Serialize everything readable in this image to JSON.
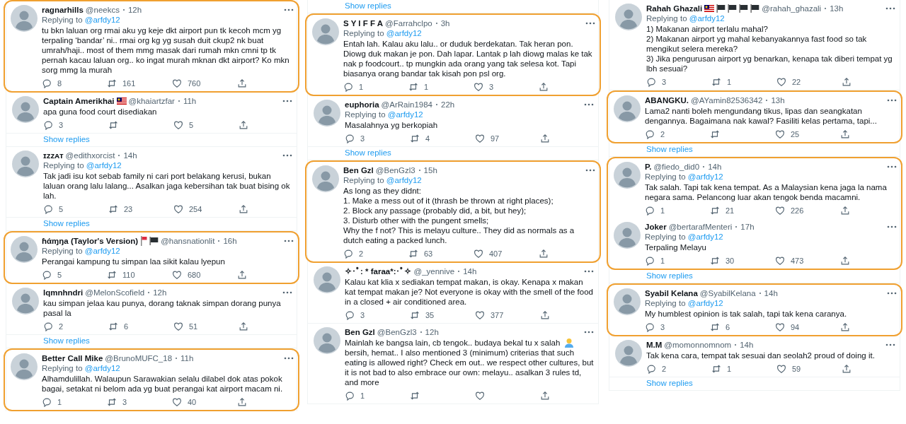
{
  "columns": [
    {
      "items": [
        {
          "kind": "tweet",
          "name": "ragnarhills",
          "handle": "@neekcs",
          "time": "12h",
          "reply_prefix": "Replying to",
          "reply_to": "@arfdy12",
          "text": [
            "tu bkn laluan org rmai aku yg keje dkt airport pun tk kecoh mcm yg terpaling ‘bandar’ ni.. rmai org kg yg susah duit ckup2 nk buat umrah/haji.. most of them mmg masak dari rumah mkn cmni tp tk pernah kacau laluan org.. ko ingat murah mknan dkt airport? Ko mkn sorg mmg la murah"
          ],
          "stats": {
            "replies": "8",
            "retweets": "161",
            "likes": "760"
          },
          "highlighted": true
        },
        {
          "kind": "tweet",
          "name": "Captain Amerikhai",
          "badges": [
            {
              "kind": "malaysia_flag"
            }
          ],
          "handle": "@khaiartzfar",
          "time": "11h",
          "text": [
            "apa guna food court disediakan"
          ],
          "stats": {
            "replies": "3",
            "likes": "5"
          },
          "highlighted": false
        },
        {
          "kind": "show_replies",
          "label": "Show replies"
        },
        {
          "kind": "tweet",
          "name": "ɪᴢᴢᴀᴛ",
          "handle": "@edithxorcist",
          "time": "14h",
          "reply_prefix": "Replying to",
          "reply_to": "@arfdy12",
          "text": [
            "Tak jadi isu kot sebab family ni cari port belakang kerusi, bukan laluan orang lalu lalang... Asalkan jaga kebersihan tak buat bising ok lah."
          ],
          "stats": {
            "replies": "5",
            "retweets": "23",
            "likes": "254"
          },
          "highlighted": false
        },
        {
          "kind": "show_replies",
          "label": "Show replies"
        },
        {
          "kind": "tweet",
          "name": "ɦάɱŋa (Taylor's Version)",
          "badges": [
            {
              "kind": "red_flag"
            },
            {
              "kind": "black_flag"
            }
          ],
          "handle": "@hansnationlit",
          "time": "16h",
          "reply_prefix": "Replying to",
          "reply_to": "@arfdy12",
          "text": [
            "Perangai kampung tu simpan laa sikit kalau lyepun"
          ],
          "stats": {
            "replies": "5",
            "retweets": "110",
            "likes": "680"
          },
          "highlighted": true
        },
        {
          "kind": "tweet",
          "name": "lqmnhndri",
          "handle": "@MelonScofield",
          "time": "12h",
          "text": [
            "kau simpan jelaa kau punya, dorang taknak simpan dorang punya pasal la"
          ],
          "stats": {
            "replies": "2",
            "retweets": "6",
            "likes": "51"
          },
          "highlighted": false
        },
        {
          "kind": "show_replies",
          "label": "Show replies"
        },
        {
          "kind": "tweet",
          "name": "Better Call Mike",
          "handle": "@BrunoMUFC_18",
          "time": "11h",
          "reply_prefix": "Replying to",
          "reply_to": "@arfdy12",
          "text": [
            "Alhamdulillah. Walaupun Sarawakian selalu dilabel dok atas pokok bagai, setakat ni belom ada yg buat perangai kat airport macam ni."
          ],
          "stats": {
            "replies": "1",
            "retweets": "3",
            "likes": "40"
          },
          "highlighted": true
        }
      ]
    },
    {
      "items": [
        {
          "kind": "show_replies",
          "label": "Show replies"
        },
        {
          "kind": "tweet",
          "name": "S Y I F F A",
          "handle": "@Farrahclpo",
          "time": "3h",
          "reply_prefix": "Replying to",
          "reply_to": "@arfdy12",
          "text": [
            "Entah lah. Kalau aku lalu.. or duduk berdekatan. Tak heran pon. Diowg duk makan je pon. Dah lapar. Lantak p lah diowg malas ke tak nak p foodcourt.. tp mungkin ada orang yang tak selesa kot. Tapi biasanya orang bandar tak kisah pon psl org."
          ],
          "stats": {
            "replies": "1",
            "retweets": "1",
            "likes": "3"
          },
          "highlighted": true
        },
        {
          "kind": "tweet",
          "name": "euphoria",
          "handle": "@ArRain1984",
          "time": "22h",
          "reply_prefix": "Replying to",
          "reply_to": "@arfdy12",
          "text": [
            "Masalahnya yg berkopiah"
          ],
          "stats": {
            "replies": "3",
            "retweets": "4",
            "likes": "97"
          },
          "highlighted": false
        },
        {
          "kind": "show_replies",
          "label": "Show replies"
        },
        {
          "kind": "tweet",
          "name": "Ben Gzl",
          "handle": "@BenGzl3",
          "time": "15h",
          "reply_prefix": "Replying to",
          "reply_to": "@arfdy12",
          "text": [
            "As long as they didnt:\n1. Make a mess out of it (thrash be thrown at right places);\n2. Block any passage (probably did, a bit, but hey);\n3. Disturb other with the pungent smells;\nWhy the f not? This is melayu culture.. They did as normals as a dutch eating a packed lunch."
          ],
          "stats": {
            "replies": "2",
            "retweets": "63",
            "likes": "407"
          },
          "highlighted": true
        },
        {
          "kind": "tweet",
          "name": "✧･ﾟ: * faraa*:･ﾟ✧",
          "handle": "@_yennive",
          "time": "14h",
          "text": [
            "Kalau kat klia x sediakan tempat makan, is okay. Kenapa x makan kat tempat makan je? Not everyone is okay with the smell of the food in a closed + air conditioned area."
          ],
          "stats": {
            "replies": "3",
            "retweets": "35",
            "likes": "377"
          },
          "highlighted": false
        },
        {
          "kind": "tweet",
          "name": "Ben Gzl",
          "handle": "@BenGzl3",
          "time": "12h",
          "text": [
            "Mainlah ke bangsa lain, cb tengok.. budaya bekal tu x salah",
            "bersih, hemat.. I also mentioned 3 (minimum) criterias that such eating is allowed right? Check em out.. we respect other cultures, but it is not bad to also embrace our own: melayu.. asalkan 3 rules td, and more"
          ],
          "stats": {
            "replies": "1"
          },
          "highlighted": false
        }
      ]
    },
    {
      "items": [
        {
          "kind": "tweet",
          "name": "Rahah Ghazali",
          "badges": [
            {
              "kind": "malaysia_flag"
            },
            {
              "kind": "black_flag"
            },
            {
              "kind": "black_flag"
            },
            {
              "kind": "black_flag"
            },
            {
              "kind": "black_flag"
            }
          ],
          "handle": "@rahah_ghazali",
          "time": "13h",
          "reply_prefix": "Replying to",
          "reply_to": "@arfdy12",
          "text": [
            "1) Makanan airport terlalu mahal?\n2) Makanan airport yg mahal  kebanyakannya fast food so tak mengikut selera mereka?\n3) Jika pengurusan airport yg benarkan, kenapa tak diberi tempat yg lbh sesuai?"
          ],
          "stats": {
            "replies": "3",
            "retweets": "1",
            "likes": "22"
          },
          "highlighted": false
        },
        {
          "kind": "tweet",
          "name": "ABANGKU.",
          "handle": "@AYamin82536342",
          "time": "13h",
          "text": [
            "Lama2 nanti boleh mengundang tikus, lipas dan seangkatan dengannya. Bagaimana nak kawal? Fasiliti kelas pertama, tapi..."
          ],
          "stats": {
            "replies": "2",
            "likes": "25"
          },
          "highlighted": true
        },
        {
          "kind": "show_replies",
          "label": "Show replies"
        },
        {
          "kind": "tweet",
          "name": "P.",
          "handle": "@fiedo_did0",
          "time": "14h",
          "reply_prefix": "Replying to",
          "reply_to": "@arfdy12",
          "text": [
            "Tak salah. Tapi tak kena tempat. As a Malaysian kena jaga la nama negara sama. Pelancong luar akan tengok benda macamni."
          ],
          "stats": {
            "replies": "1",
            "retweets": "21",
            "likes": "226"
          },
          "highlighted": true
        },
        {
          "kind": "tweet",
          "name": "Joker",
          "handle": "@bertarafMenteri",
          "time": "17h",
          "reply_prefix": "Replying to",
          "reply_to": "@arfdy12",
          "text": [
            "Terpaling Melayu"
          ],
          "stats": {
            "replies": "1",
            "retweets": "30",
            "likes": "473"
          },
          "highlighted": true
        },
        {
          "kind": "show_replies",
          "label": "Show replies"
        },
        {
          "kind": "tweet",
          "name": "Syabil Kelana",
          "handle": "@SyabilKelana",
          "time": "14h",
          "reply_prefix": "Replying to",
          "reply_to": "@arfdy12",
          "text": [
            "My humblest opinion is tak salah, tapi tak kena caranya."
          ],
          "stats": {
            "replies": "3",
            "retweets": "6",
            "likes": "94"
          },
          "highlighted": true
        },
        {
          "kind": "tweet",
          "name": "M.M",
          "handle": "@momonnomnom",
          "time": "14h",
          "text": [
            "Tak kena cara, tempat tak sesuai dan seolah2 proud of doing it."
          ],
          "stats": {
            "replies": "2",
            "retweets": "1",
            "likes": "59"
          },
          "highlighted": false
        },
        {
          "kind": "show_replies",
          "label": "Show replies"
        }
      ]
    }
  ]
}
